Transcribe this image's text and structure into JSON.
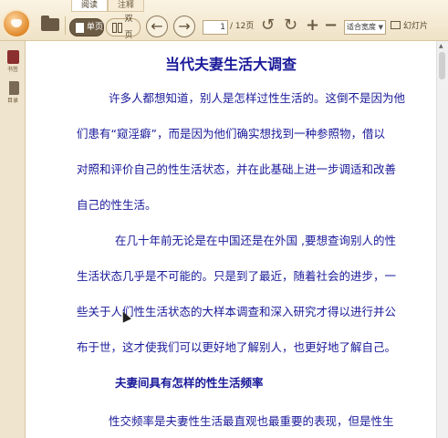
{
  "tabs": [
    "阅读",
    "注释"
  ],
  "toolbar": {
    "single_page": "单页",
    "double_page": "双页",
    "page_current": "1",
    "page_total": "/ 12页",
    "zoom": "适合宽度",
    "slideshow": "幻灯片"
  },
  "sidebar": {
    "bookmark": "书签",
    "toc": "目录"
  },
  "document": {
    "title": "当代夫妻生活大调查",
    "lines": [
      "许多人都想知道，别人是怎样过性生活的。这倒不是因为他",
      "们患有“窥淫癖”，而是因为他们确实想找到一种参照物，借以",
      "对照和评价自己的性生活状态，并在此基础上进一步调适和改善",
      "自己的性生活。",
      "在几十年前无论是在中国还是在外国 ,要想查询别人的性",
      "生活状态几乎是不可能的。只是到了最近，随着社会的进步，一",
      "些关于人们性生活状态的大样本调查和深入研究才得以进行并公",
      "布于世，这才使我们可以更好地了解别人，也更好地了解自己。"
    ],
    "heading": "夫妻间具有怎样的性生活频率",
    "last_line": "性交频率是夫妻性生活最直观也最重要的表现，但是性生"
  }
}
